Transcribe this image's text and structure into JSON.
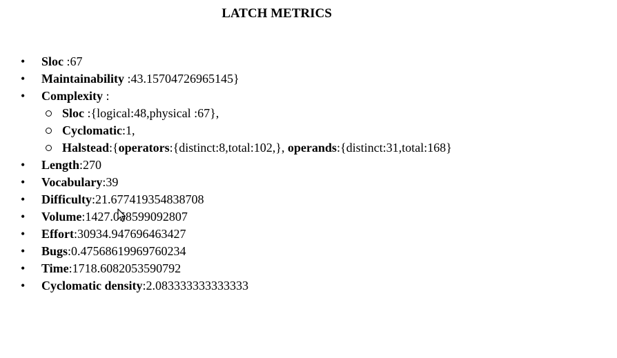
{
  "title": "LATCH METRICS",
  "metrics": {
    "sloc": {
      "label": "Sloc",
      "value": " :67"
    },
    "maintainability": {
      "label": "Maintainability",
      "value": " :43.15704726965145}"
    },
    "complexity": {
      "label": "Complexity",
      "value": " :",
      "sloc": {
        "label": "Sloc",
        "value": " :{logical:48,physical :67},"
      },
      "cyclomatic": {
        "label": "Cyclomatic",
        "value": ":1,"
      },
      "halstead": {
        "label": "Halstead",
        "sep": ":{",
        "operators_label": "operators",
        "operators_value": ":{distinct:8,total:102,},",
        "operands_label": "operands",
        "operands_value": ":{distinct:31,total:168}"
      }
    },
    "length": {
      "label": "Length",
      "value": ":270"
    },
    "vocabulary": {
      "label": "Vocabulary",
      "value": ":39"
    },
    "difficulty": {
      "label": "Difficulty",
      "value": ":21.677419354838708"
    },
    "volume": {
      "label": "Volume",
      "value": ":1427.058599092807"
    },
    "effort": {
      "label": "Effort",
      "value": ":30934.947696463427"
    },
    "bugs": {
      "label": "Bugs",
      "value": ":0.47568619969760234"
    },
    "time": {
      "label": "Time",
      "value": ":1718.6082053590792"
    },
    "cyclomatic_density": {
      "label": "Cyclomatic density",
      "value": ":2.083333333333333"
    }
  },
  "cursor": {
    "icon": "mouse-pointer-icon"
  }
}
